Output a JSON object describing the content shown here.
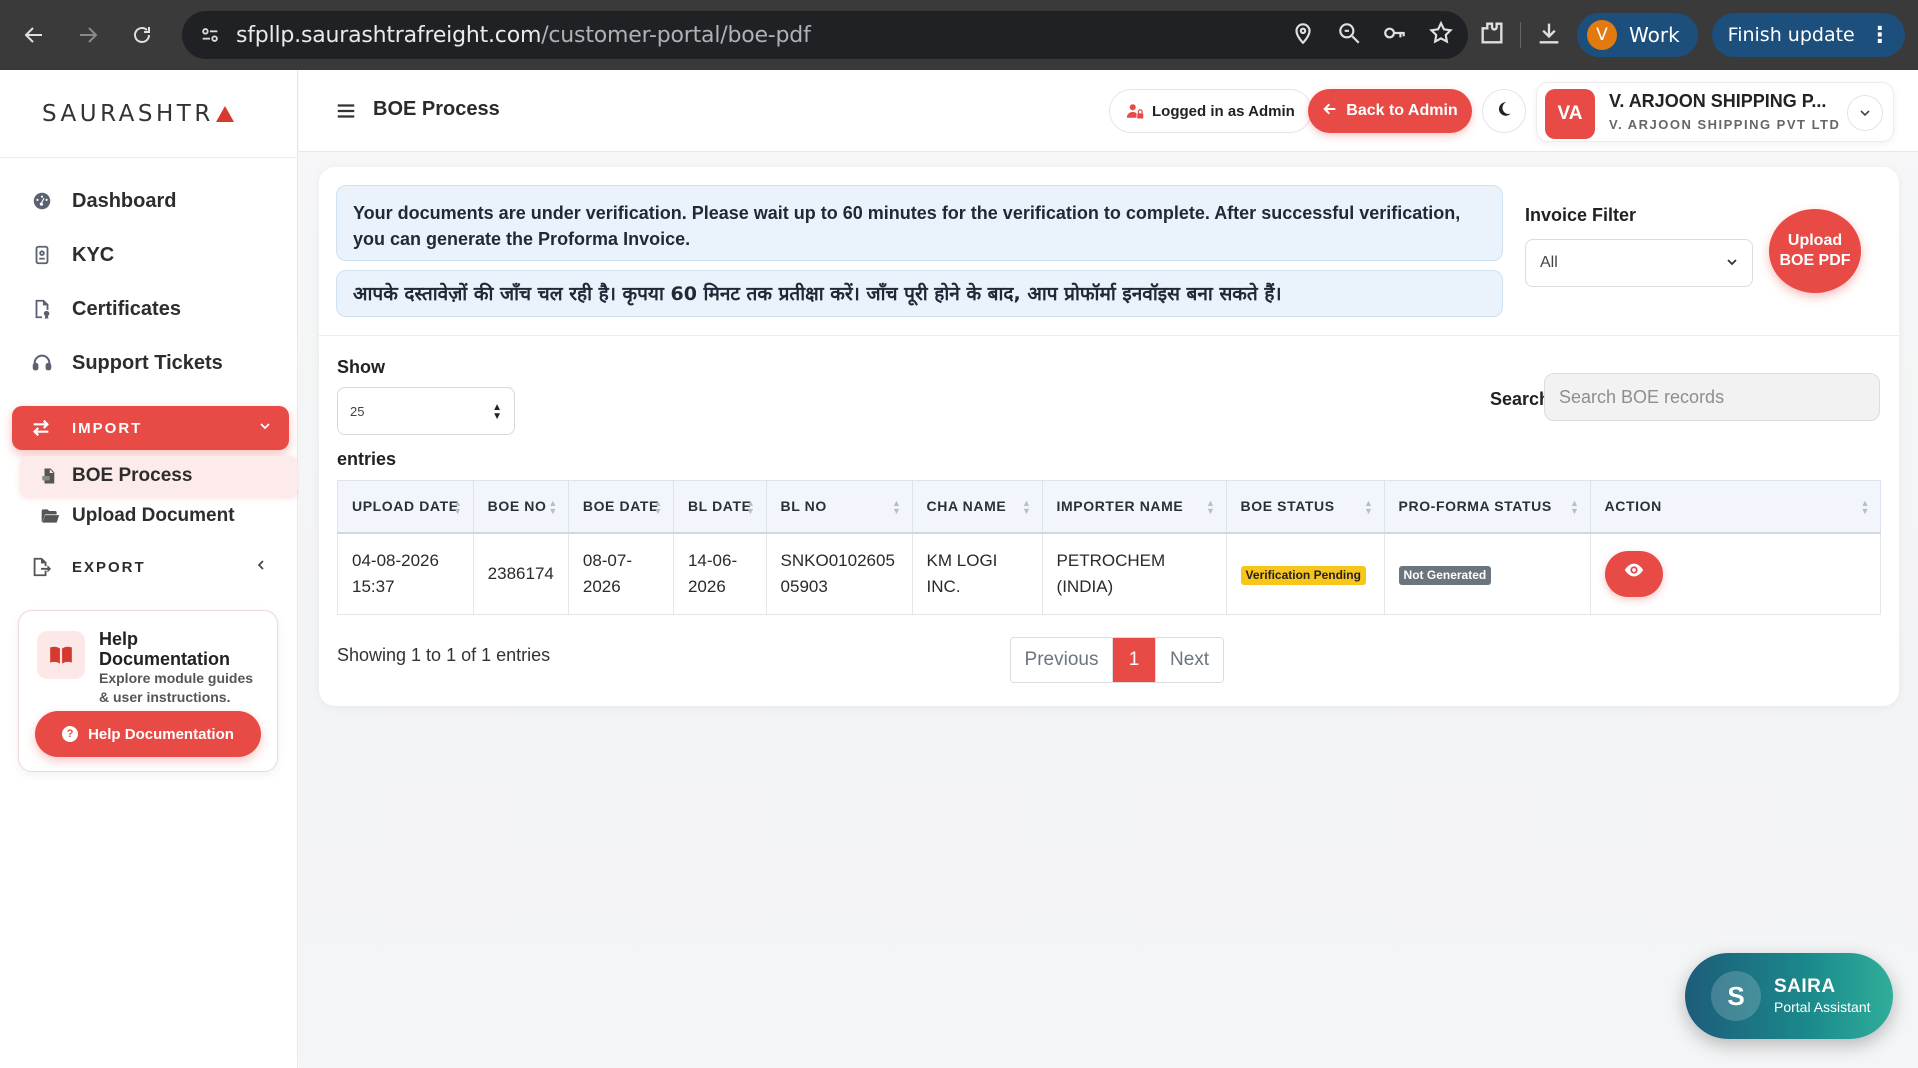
{
  "browser": {
    "url_domain": "sfpllp.saurashtrafreight.com",
    "url_path": "/customer-portal/boe-pdf",
    "profile_initial": "V",
    "profile_label": "Work",
    "update_label": "Finish update",
    "icons": [
      "back-icon",
      "forward-icon",
      "reload-icon",
      "site-info-icon",
      "location-icon",
      "zoom-icon",
      "key-icon",
      "star-icon",
      "extensions-icon",
      "download-icon",
      "menu-dots-icon"
    ]
  },
  "sidebar": {
    "logo_text": "SAURASHTR",
    "items": [
      {
        "label": "Dashboard",
        "icon": "dashboard-icon"
      },
      {
        "label": "KYC",
        "icon": "id-card-icon"
      },
      {
        "label": "Certificates",
        "icon": "certificate-icon"
      },
      {
        "label": "Support Tickets",
        "icon": "headset-icon"
      }
    ],
    "import_label": "IMPORT",
    "import_children": [
      {
        "label": "BOE Process",
        "icon": "pdf-file-icon"
      },
      {
        "label": "Upload Document",
        "icon": "folder-open-icon"
      }
    ],
    "export_label": "EXPORT",
    "help": {
      "title": "Help Documentation",
      "description": "Explore module guides & user instructions.",
      "button_label": "Help Documentation"
    }
  },
  "header": {
    "page_title": "BOE Process",
    "logged_in_label": "Logged in as Admin",
    "back_label": "Back to Admin",
    "profile": {
      "initials": "VA",
      "name": "V. ARJOON SHIPPING P...",
      "company": "V. ARJOON SHIPPING PVT LTD"
    }
  },
  "notices": {
    "english": "Your documents are under verification. Please wait up to 60 minutes for the verification to complete. After successful verification, you can generate the Proforma Invoice.",
    "hindi": "आपके दस्तावेज़ों की जाँच चल रही है। कृपया 60 मिनट तक प्रतीक्षा करें। जाँच पूरी होने के बाद, आप प्रोफॉर्मा इनवॉइस बना सकते हैं।"
  },
  "filter": {
    "label": "Invoice Filter",
    "selected": "All",
    "upload_label": "Upload BOE PDF"
  },
  "table_controls": {
    "show_label": "Show",
    "page_length": "25",
    "entries_label": "entries",
    "search_label": "Search",
    "search_placeholder": "Search BOE records"
  },
  "table": {
    "columns": [
      "UPLOAD DATE",
      "BOE NO",
      "BOE DATE",
      "BL DATE",
      "BL NO",
      "CHA NAME",
      "IMPORTER NAME",
      "BOE STATUS",
      "PRO-FORMA STATUS",
      "ACTION"
    ],
    "rows": [
      {
        "upload_date": "04-08-2026 15:37",
        "boe_no": "2386174",
        "boe_date": "08-07-2026",
        "bl_date": "14-06-2026",
        "bl_no": "SNKO0102605 05903",
        "cha_name": "KM LOGI INC.",
        "importer_name": "PETROCHEM (INDIA)",
        "boe_status": "Verification Pending",
        "proforma_status": "Not Generated"
      }
    ]
  },
  "pagination": {
    "info": "Showing 1 to 1 of 1 entries",
    "previous": "Previous",
    "current": "1",
    "next": "Next"
  },
  "assistant": {
    "initial": "S",
    "name": "SAIRA",
    "subtitle": "Portal Assistant"
  },
  "colors": {
    "accent": "#e84a45",
    "notice_bg": "#eaf3fb",
    "pending_badge": "#f7c51c",
    "not_generated_badge": "#6c757d",
    "browser_chrome": "#3a3a3a"
  }
}
